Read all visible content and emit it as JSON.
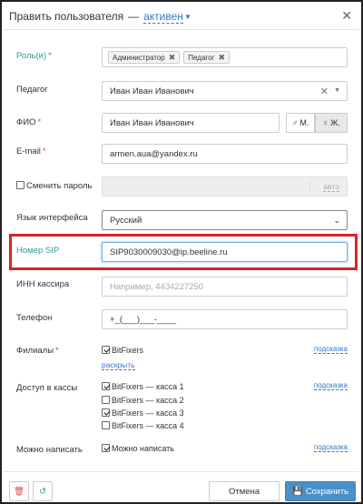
{
  "header": {
    "title": "Править пользователя",
    "dash": "—",
    "status": "активен",
    "close_icon": "close-icon"
  },
  "form": {
    "roles": {
      "label": "Роль(и)",
      "tags": [
        "Администратор",
        "Педагог"
      ]
    },
    "teacher": {
      "label": "Педагог",
      "value": "Иван Иван Иванович"
    },
    "fio": {
      "label": "ФИО",
      "value": "Иван Иван Иванович",
      "gender_male": "М.",
      "gender_female": "Ж."
    },
    "email": {
      "label": "E-mail",
      "value": "armen.aua@yandex.ru"
    },
    "password": {
      "label": "Сменить пароль",
      "auto": "авто",
      "checked": false
    },
    "language": {
      "label": "Язык интерфейса",
      "value": "Русский"
    },
    "sip": {
      "label": "Номер SIP",
      "value": "SIP9030009030@ip.beeline.ru"
    },
    "inn": {
      "label": "ИНН кассира",
      "placeholder": "Например, 4434227250"
    },
    "phone": {
      "label": "Телефон",
      "value": "+_(___)___-____"
    },
    "branches": {
      "label": "Филиалы",
      "items": [
        {
          "label": "BitFixers",
          "checked": true
        }
      ],
      "expand": "раскрыть",
      "hint": "подсказка"
    },
    "cash": {
      "label": "Доступ в кассы",
      "items": [
        {
          "label": "BitFixers — касса 1",
          "checked": true
        },
        {
          "label": "BitFixers — касса 2",
          "checked": false
        },
        {
          "label": "BitFixers — касса 3",
          "checked": true
        },
        {
          "label": "BitFixers — касса 4",
          "checked": false
        }
      ],
      "hint": "подсказка"
    },
    "can_write": {
      "label": "Можно написать",
      "items": [
        {
          "label": "Можно написать",
          "checked": true
        }
      ],
      "hint": "подсказка"
    }
  },
  "footer": {
    "cancel": "Отмена",
    "save": "Сохранить"
  },
  "colors": {
    "accent": "#3a75c4",
    "highlight": "#d62728",
    "save_button": "#4a90c8",
    "required": "#e0443a"
  }
}
